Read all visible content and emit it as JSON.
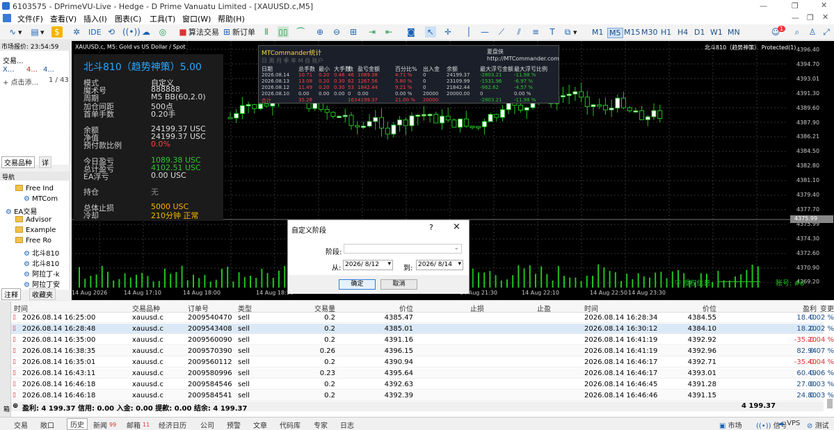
{
  "window": {
    "title": "6103575 - DPrimeVU-Live - Hedge - D Prime Vanuatu Limited - [XAUUSD.c,M5]"
  },
  "menu": [
    "文件(F)",
    "查看(V)",
    "插入(I)",
    "图表(C)",
    "工具(T)",
    "窗口(W)",
    "帮助(H)"
  ],
  "toolbar": {
    "algo": "算法交易",
    "new_order": "新订单",
    "ide": "IDE",
    "timeframes": [
      "M1",
      "M5",
      "M15",
      "M30",
      "H1",
      "H4",
      "D1",
      "W1",
      "MN"
    ],
    "selected_tf": "M5",
    "notif": "1"
  },
  "market_watch": {
    "title": "市场报价: 23:54:59",
    "col_symbol": "交易...",
    "row_symbol": "X...",
    "row_val": "4...",
    "row_val2": "4...",
    "add": "+ 点击添...",
    "count": "1 / 43",
    "tab1": "交易品种",
    "tab2": "详"
  },
  "navigator": {
    "title": "导航",
    "items": [
      "Free Ind",
      "MTCom",
      "EA交易",
      "Advisor",
      "Example",
      "Free Ro",
      "北斗810",
      "北斗810",
      "阿拉丁-k",
      "阿拉丁安"
    ],
    "tab1": "注释",
    "tab2": "收藏夹"
  },
  "chart": {
    "header": "XAUUSD.c, M5:  Gold vs US Dollar / Spot",
    "ea_label": "北斗810（趋势神策）  Protected(1)",
    "trade_info": "授权信息",
    "account": "账号: #6",
    "price_labels": [
      "4396.40",
      "4394.70",
      "4393.01",
      "4391.30",
      "4389.60",
      "4387.90",
      "4386.21",
      "4384.50",
      "4382.80",
      "4381.10",
      "4379.40",
      "4377.70",
      "4375.99",
      "4374.30",
      "4372.60",
      "4370.90",
      "4369.20"
    ],
    "current_price": "4375.99",
    "time_labels": [
      "14 Aug 2026",
      "14 Aug 17:10",
      "14 Aug 18:00",
      "14 Aug 18:50",
      "14 Aug 21:30",
      "14 Aug 22:10",
      "14 Aug 22:50",
      "14 Aug 23:30"
    ]
  },
  "ea_panel": {
    "title": "北斗810（趋势神策）5.00",
    "rows": [
      [
        "模式",
        "自定义"
      ],
      [
        "魔术号",
        "888888"
      ],
      [
        "周期",
        "M5  BB(60,2.0)"
      ],
      [
        "加仓间距",
        "500点"
      ],
      [
        "首单手数",
        "0.20手"
      ],
      [
        "余额",
        "24199.37 USC"
      ],
      [
        "净值",
        "24199.37 USC"
      ],
      [
        "预付款比例",
        "0.0%"
      ],
      [
        "今日盈亏",
        "1089.38 USC"
      ],
      [
        "总计盈亏",
        "4102.51 USC"
      ],
      [
        "EA浮亏",
        "0.00 USC"
      ],
      [
        "持仓",
        "无"
      ],
      [
        "总体止损",
        "5000 USC"
      ],
      [
        "冷却",
        "210分钟  正常"
      ]
    ]
  },
  "mtc": {
    "title": "MTCommander统计",
    "brand": "夏盘侠  http://MTCommander.com",
    "tabs": "日  周  月  季  年  M  自  账户",
    "headers": [
      "日期",
      "总手数",
      "最小",
      "大手数",
      "数",
      "盈亏金额",
      "百分比%",
      "出入金",
      "余额",
      "最大浮亏金额",
      "最大浮亏比例"
    ],
    "rows": [
      [
        "2026.08.14",
        "10.71",
        "0.20",
        "0.46",
        "46",
        "1089.38",
        "4.71 %",
        "0",
        "24199.37",
        "-2803.21",
        "-11.98 %"
      ],
      [
        "2026.08.13",
        "13.08",
        "0.20",
        "0.30",
        "62",
        "1267.56",
        "5.80 %",
        "0",
        "23109.99",
        "-1531.96",
        "-6.97 %"
      ],
      [
        "2026.08.12",
        "11.49",
        "0.20",
        "0.30",
        "53",
        "1842.44",
        "9.21 %",
        "0",
        "21842.44",
        "-962.62",
        "-4.57 %"
      ],
      [
        "2026.08.10",
        "0.00",
        "0.00",
        "0.00",
        "0",
        "0.00",
        "0.00 %",
        "20000",
        "20000.00",
        "0",
        "0.00 %"
      ],
      [
        "合计",
        "35.28",
        "",
        "",
        "163",
        "4199.37",
        "21.00 %",
        "20000",
        "",
        "-2803.21",
        "-11.98 %"
      ]
    ]
  },
  "dialog": {
    "title": "自定义阶段",
    "help": "?",
    "close": "×",
    "stage_label": "阶段:",
    "stage_value": "",
    "from_label": "从:",
    "from_value": "2026/ 8/12",
    "to_label": "到:",
    "to_value": "2026/ 8/14",
    "ok": "确定",
    "cancel": "取消"
  },
  "table": {
    "headers": [
      "时间",
      "交易品种",
      "订单号",
      "类型",
      "交易量",
      "价位",
      "止损",
      "止盈",
      "时间",
      "价位",
      "盈利",
      "变更"
    ],
    "rows": [
      [
        "2026.08.14 16:25:00",
        "xauusd.c",
        "2009540470",
        "sell",
        "0.2",
        "4385.47",
        "",
        "",
        "2026.08.14 16:28:34",
        "4384.55",
        "18.40",
        "0.02 %"
      ],
      [
        "2026.08.14 16:28:48",
        "xauusd.c",
        "2009543408",
        "sell",
        "0.2",
        "4385.01",
        "",
        "",
        "2026.08.14 16:30:12",
        "4384.10",
        "18.20",
        "0.02 %"
      ],
      [
        "2026.08.14 16:35:00",
        "xauusd.c",
        "2009560090",
        "sell",
        "0.2",
        "4391.16",
        "",
        "",
        "2026.08.14 16:41:19",
        "4392.92",
        "-35.20",
        "-0.04 %"
      ],
      [
        "2026.08.14 16:38:35",
        "xauusd.c",
        "2009570390",
        "sell",
        "0.26",
        "4396.15",
        "",
        "",
        "2026.08.14 16:41:19",
        "4392.96",
        "82.94",
        "0.07 %"
      ],
      [
        "2026.08.14 16:35:01",
        "xauusd.c",
        "2009560112",
        "sell",
        "0.2",
        "4390.94",
        "",
        "",
        "2026.08.14 16:46:17",
        "4392.71",
        "-35.40",
        "-0.04 %"
      ],
      [
        "2026.08.14 16:43:11",
        "xauusd.c",
        "2009580996",
        "sell",
        "0.23",
        "4395.64",
        "",
        "",
        "2026.08.14 16:46:17",
        "4393.01",
        "60.49",
        "0.06 %"
      ],
      [
        "2026.08.14 16:46:18",
        "xauusd.c",
        "2009584546",
        "sell",
        "0.2",
        "4392.63",
        "",
        "",
        "2026.08.14 16:46:45",
        "4391.28",
        "27.00",
        "0.03 %"
      ],
      [
        "2026.08.14 16:46:18",
        "xauusd.c",
        "2009584541",
        "sell",
        "0.2",
        "4392.39",
        "",
        "",
        "2026.08.14 16:46:46",
        "4391.15",
        "24.80",
        "0.03 %"
      ]
    ],
    "summary": "盈利: 4 199.37  信用: 0.00  入金: 0.00  提款: 0.00  结余: 4 199.37",
    "summary_total": "4 199.37"
  },
  "status_tabs": [
    "交易",
    "敞口",
    "历史",
    "新闻",
    "邮箱",
    "经济日历",
    "公司",
    "预警",
    "文章",
    "代码库",
    "专家",
    "日志"
  ],
  "news_count": "99",
  "mail_count": "11",
  "status_right": [
    "市场",
    "信号",
    "VPS",
    "测试"
  ],
  "toolbox_label": "工具箱"
}
